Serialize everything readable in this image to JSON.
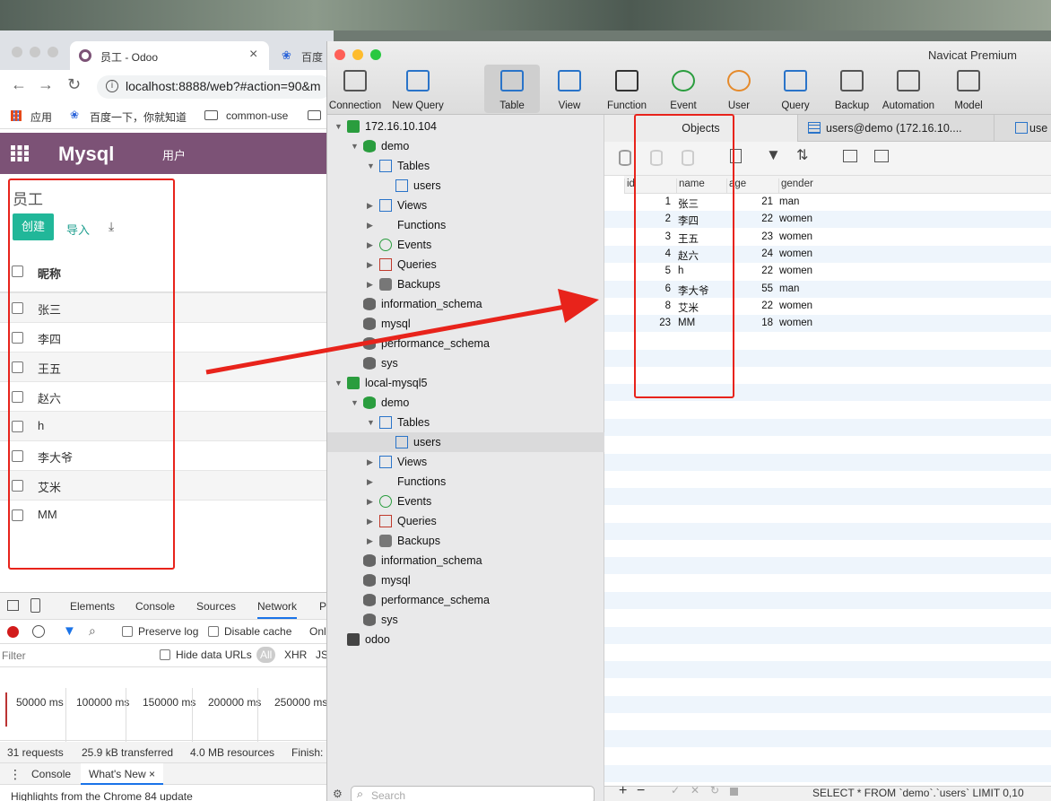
{
  "chrome": {
    "tab_active": "员工 - Odoo",
    "tab_close": "×",
    "tab_2": "百度",
    "url": "localhost:8888/web?#action=90&m",
    "bookmarks": [
      {
        "label": "应用",
        "icon": "apps-grid-icon"
      },
      {
        "label": "百度一下，你就知道",
        "icon": "baidu-paw-icon"
      },
      {
        "label": "common-use",
        "icon": "folder-icon"
      }
    ]
  },
  "odoo": {
    "brand": "Mysql",
    "menu_user": "用户",
    "page_title": "员工",
    "btn_create": "创建",
    "btn_import": "导入",
    "col_nickname": "昵称",
    "rows": [
      "张三",
      "李四",
      "王五",
      "赵六",
      "h",
      "李大爷",
      "艾米",
      "MM"
    ],
    "accent_color": "#7c5276",
    "create_color": "#21b799"
  },
  "devtools": {
    "tabs": [
      "Elements",
      "Console",
      "Sources",
      "Network",
      "P"
    ],
    "active_tab": "Network",
    "preserve_log": "Preserve log",
    "disable_cache": "Disable cache",
    "online": "Onl",
    "filter_placeholder": "Filter",
    "hide_data_urls": "Hide data URLs",
    "all": "All",
    "xhr": "XHR",
    "js": "JS",
    "timeline": [
      "50000 ms",
      "100000 ms",
      "150000 ms",
      "200000 ms",
      "250000 ms"
    ],
    "status": [
      "31 requests",
      "25.9 kB transferred",
      "4.0 MB resources",
      "Finish:"
    ],
    "drawer_tabs": [
      "Console",
      "What's New"
    ],
    "drawer_close": "×",
    "drawer_text": "Highlights from the Chrome 84 update"
  },
  "navicat": {
    "title": "Navicat Premium",
    "toolbar": [
      "Connection",
      "New Query",
      "Table",
      "View",
      "Function",
      "Event",
      "User",
      "Query",
      "Backup",
      "Automation",
      "Model"
    ],
    "toolbar_active": "Table",
    "tree1": {
      "connection": "172.16.10.104",
      "db": "demo",
      "tables": "Tables",
      "table": "users",
      "items": [
        "Views",
        "Functions",
        "Events",
        "Queries",
        "Backups"
      ],
      "other_dbs": [
        "information_schema",
        "mysql",
        "performance_schema",
        "sys"
      ]
    },
    "tree2": {
      "connection": "local-mysql5",
      "db": "demo",
      "tables": "Tables",
      "table": "users",
      "items": [
        "Views",
        "Functions",
        "Events",
        "Queries",
        "Backups"
      ],
      "other_dbs": [
        "information_schema",
        "mysql",
        "performance_schema",
        "sys"
      ]
    },
    "odoo_conn": "odoo",
    "search_placeholder": "Search",
    "tabs": [
      "Objects",
      "users@demo (172.16.10....",
      "use"
    ],
    "columns": [
      "id",
      "name",
      "age",
      "gender"
    ],
    "rows": [
      {
        "id": "1",
        "name": "张三",
        "age": "21",
        "gender": "man"
      },
      {
        "id": "2",
        "name": "李四",
        "age": "22",
        "gender": "women"
      },
      {
        "id": "3",
        "name": "王五",
        "age": "23",
        "gender": "women"
      },
      {
        "id": "4",
        "name": "赵六",
        "age": "24",
        "gender": "women"
      },
      {
        "id": "5",
        "name": "h",
        "age": "22",
        "gender": "women"
      },
      {
        "id": "6",
        "name": "李大爷",
        "age": "55",
        "gender": "man"
      },
      {
        "id": "8",
        "name": "艾米",
        "age": "22",
        "gender": "women"
      },
      {
        "id": "23",
        "name": "MM",
        "age": "18",
        "gender": "women"
      }
    ],
    "sql": "SELECT * FROM `demo`.`users` LIMIT 0,10"
  },
  "annotation": {
    "color": "#e8231b"
  }
}
